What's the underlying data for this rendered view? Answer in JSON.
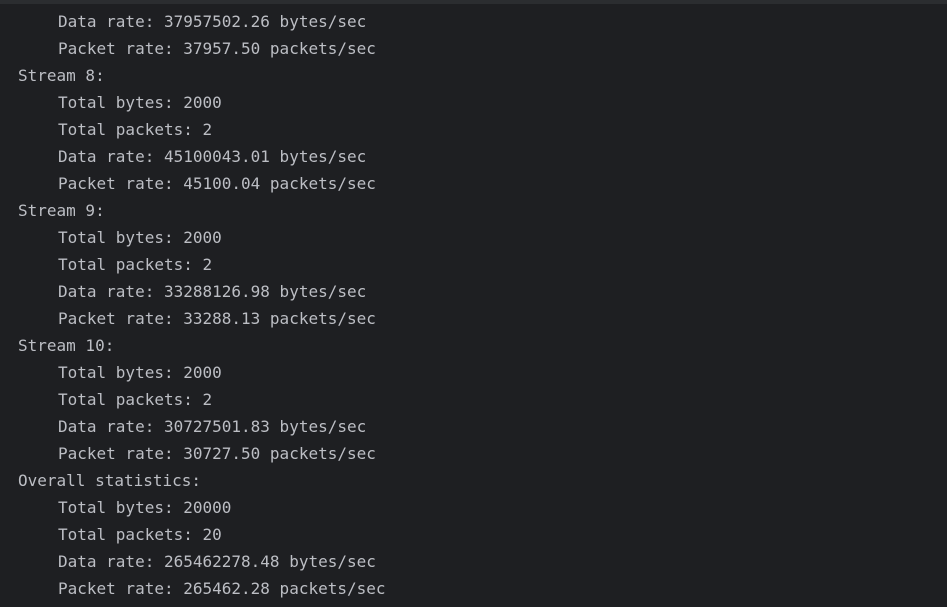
{
  "console": {
    "lines": [
      {
        "indent": 1,
        "text": "Data rate: 37957502.26 bytes/sec"
      },
      {
        "indent": 1,
        "text": "Packet rate: 37957.50 packets/sec"
      },
      {
        "indent": 0,
        "text": "Stream 8:"
      },
      {
        "indent": 1,
        "text": "Total bytes: 2000"
      },
      {
        "indent": 1,
        "text": "Total packets: 2"
      },
      {
        "indent": 1,
        "text": "Data rate: 45100043.01 bytes/sec"
      },
      {
        "indent": 1,
        "text": "Packet rate: 45100.04 packets/sec"
      },
      {
        "indent": 0,
        "text": "Stream 9:"
      },
      {
        "indent": 1,
        "text": "Total bytes: 2000"
      },
      {
        "indent": 1,
        "text": "Total packets: 2"
      },
      {
        "indent": 1,
        "text": "Data rate: 33288126.98 bytes/sec"
      },
      {
        "indent": 1,
        "text": "Packet rate: 33288.13 packets/sec"
      },
      {
        "indent": 0,
        "text": "Stream 10:"
      },
      {
        "indent": 1,
        "text": "Total bytes: 2000"
      },
      {
        "indent": 1,
        "text": "Total packets: 2"
      },
      {
        "indent": 1,
        "text": "Data rate: 30727501.83 bytes/sec"
      },
      {
        "indent": 1,
        "text": "Packet rate: 30727.50 packets/sec"
      },
      {
        "indent": 0,
        "text": "Overall statistics:"
      },
      {
        "indent": 1,
        "text": "Total bytes: 20000"
      },
      {
        "indent": 1,
        "text": "Total packets: 20"
      },
      {
        "indent": 1,
        "text": "Data rate: 265462278.48 bytes/sec"
      },
      {
        "indent": 1,
        "text": "Packet rate: 265462.28 packets/sec"
      }
    ]
  },
  "colors": {
    "background": "#1e1f22",
    "text": "#bcbec4",
    "top_strip": "#2b2d30"
  }
}
